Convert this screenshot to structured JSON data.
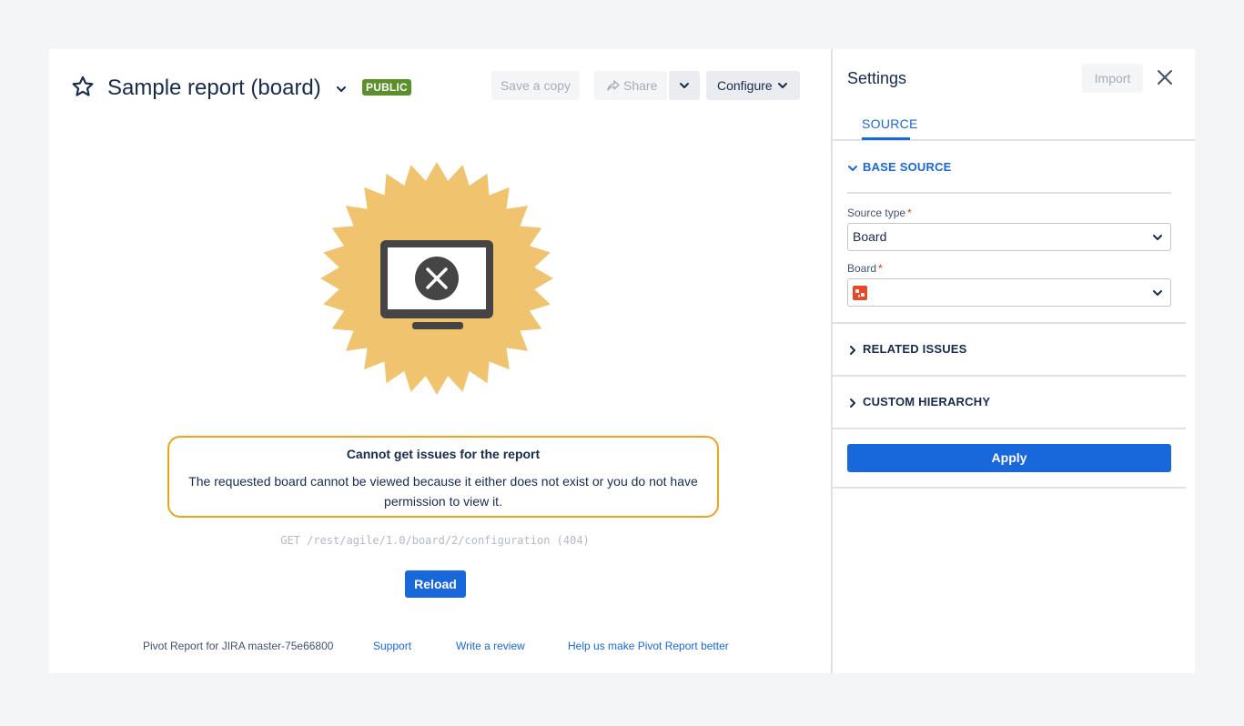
{
  "colors": {
    "accent": "#1868db",
    "public_badge": "#5a8f29",
    "error_border": "#f0a21e",
    "burst": "#f0c46e",
    "monitor": "#454545"
  },
  "header": {
    "star_icon": "star-outline-icon",
    "title": "Sample report (board)",
    "badge": "PUBLIC",
    "save_copy": "Save a copy",
    "share": "Share",
    "configure": "Configure"
  },
  "error": {
    "illustration_icon": "monitor-error-icon",
    "title": "Cannot get issues for the report",
    "message": "The requested board cannot be viewed because it either does not exist or you do not have permission to view it.",
    "request": "GET /rest/agile/1.0/board/2/configuration (404)",
    "reload": "Reload"
  },
  "footer": {
    "version": "Pivot Report for JIRA master-75e66800",
    "support": "Support",
    "review": "Write a review",
    "help": "Help us make Pivot Report better"
  },
  "settings": {
    "title": "Settings",
    "import": "Import",
    "tab_source": "SOURCE",
    "base_source": "BASE SOURCE",
    "source_type_label": "Source type",
    "source_type_value": "Board",
    "board_label": "Board",
    "board_value": "",
    "related_issues": "RELATED ISSUES",
    "custom_hierarchy": "CUSTOM HIERARCHY",
    "required_marker": "*",
    "apply": "Apply"
  }
}
